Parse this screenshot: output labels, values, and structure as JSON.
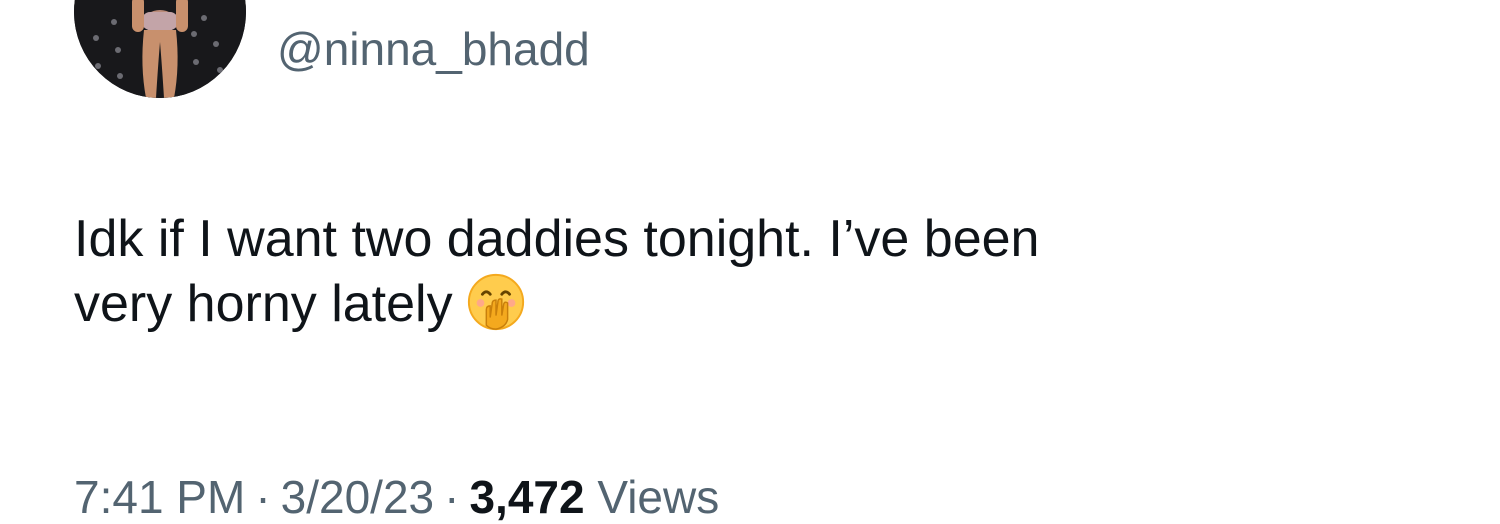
{
  "author": {
    "display_name": "",
    "handle": "@ninna_bhadd",
    "avatar_icon": "profile-photo-icon"
  },
  "tweet": {
    "text_line1": "Idk if I want two daddies tonight. I’ve been",
    "text_line2": "very horny lately",
    "emoji": "hand-over-mouth-emoji"
  },
  "meta": {
    "time": "7:41 PM",
    "separator": "·",
    "date": "3/20/23",
    "views_count": "3,472",
    "views_label": "Views"
  },
  "colors": {
    "text_primary": "#0f1419",
    "text_secondary": "#536471",
    "background": "#ffffff"
  }
}
